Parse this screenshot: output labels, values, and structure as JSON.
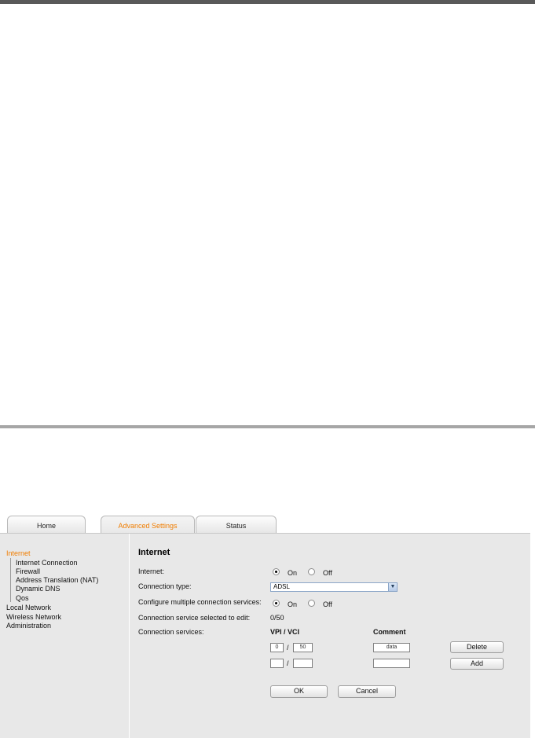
{
  "tabs": [
    {
      "label": "Home",
      "active": false
    },
    {
      "label": "Advanced Settings",
      "active": true
    },
    {
      "label": "Status",
      "active": false
    }
  ],
  "sidebar": {
    "items": [
      {
        "label": "Internet",
        "active": true
      },
      {
        "label": "Internet Connection"
      },
      {
        "label": "Firewall"
      },
      {
        "label": "Address Translation (NAT)"
      },
      {
        "label": "Dynamic DNS"
      },
      {
        "label": "Qos"
      },
      {
        "label": "Local Network"
      },
      {
        "label": "Wireless Network"
      },
      {
        "label": "Administration"
      }
    ]
  },
  "main": {
    "title": "Internet",
    "internet": {
      "label": "Internet:",
      "on": "On",
      "off": "Off",
      "selected": "On"
    },
    "connection_type": {
      "label": "Connection type:",
      "value": "ADSL"
    },
    "multiple_services": {
      "label": "Configure multiple connection services:",
      "on": "On",
      "off": "Off",
      "selected": "On"
    },
    "selected_service": {
      "label": "Connection service selected to edit:",
      "value": "0/50"
    },
    "services": {
      "label": "Connection services:",
      "col_vpi_vci": "VPI / VCI",
      "col_comment": "Comment",
      "slash": "/",
      "rows": [
        {
          "vpi": "0",
          "vci": "50",
          "comment": "data",
          "action": "Delete"
        },
        {
          "vpi": "",
          "vci": "",
          "comment": "",
          "action": "Add"
        }
      ]
    },
    "ok_label": "OK",
    "cancel_label": "Cancel"
  },
  "colors": {
    "accent": "#f07d00",
    "panel": "#e8e8e8"
  }
}
